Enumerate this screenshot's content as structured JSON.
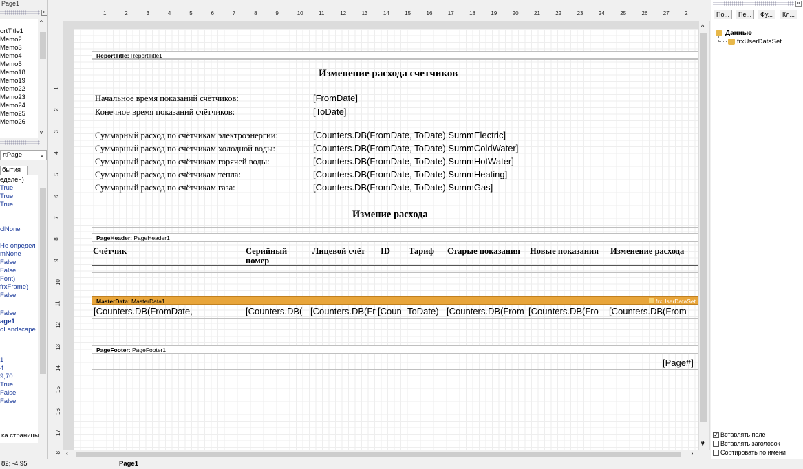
{
  "left_panel": {
    "tab_label": "Page1",
    "tree_items": [
      "ortTitle1",
      "Memo2",
      "Memo3",
      "Memo4",
      "Memo5",
      "Memo18",
      "Memo19",
      "Memo22",
      "Memo23",
      "Memo24",
      "Memo25",
      "Memo26"
    ],
    "object_select": "rtPage",
    "events_tab": "бытия",
    "property_values": [
      "еделен)",
      "True",
      "True",
      "True",
      "",
      "",
      "clNone",
      "",
      "Не определ",
      "mNone",
      "False",
      "False",
      "Font)",
      "frxFrame)",
      "False",
      "",
      "False",
      "age1",
      "oLandscape",
      "",
      "",
      "1",
      "4",
      "9,70",
      "True",
      "False",
      "False"
    ],
    "property_description": "ка страницы"
  },
  "ruler": {
    "h_ticks": [
      "1",
      "2",
      "3",
      "4",
      "5",
      "6",
      "7",
      "8",
      "9",
      "10",
      "11",
      "12",
      "13",
      "14",
      "15",
      "16",
      "17",
      "18",
      "19",
      "20",
      "21",
      "22",
      "23",
      "24",
      "25",
      "26",
      "27",
      "2"
    ],
    "v_ticks": [
      "1",
      "2",
      "3",
      "4",
      "5",
      "6",
      "7",
      "8",
      "9",
      "10",
      "11",
      "12",
      "13",
      "14",
      "15",
      "16",
      "17",
      "18"
    ]
  },
  "report": {
    "report_title_band": {
      "type": "ReportTitle:",
      "name": "ReportTitle1"
    },
    "title": "Изменение расхода счетчиков",
    "labels": [
      "Начальное время показаний счётчиков:",
      "Конечное время показаний счётчиков:",
      "Суммарный расход по счётчикам электроэнергии:",
      "Суммарный расход по счётчикам холодной воды:",
      "Суммарный расход по счётчикам горячей воды:",
      "Суммарный расход по счётчикам тепла:",
      "Суммарный расход по счётчикам газа:"
    ],
    "fields": [
      "[FromDate]",
      "[ToDate]",
      "[Counters.DB(FromDate, ToDate).SummElectric]",
      "[Counters.DB(FromDate, ToDate).SummColdWater]",
      "[Counters.DB(FromDate, ToDate).SummHotWater]",
      "[Counters.DB(FromDate, ToDate).SummHeating]",
      "[Counters.DB(FromDate, ToDate).SummGas]"
    ],
    "subtitle": "Измение расхода",
    "page_header_band": {
      "type": "PageHeader:",
      "name": "PageHeader1"
    },
    "columns": [
      "Счётчик",
      "Серийный номер",
      "Лицевой счёт",
      "ID",
      "Тариф",
      "Старые показания",
      "Новые показания",
      "Изменение расхода"
    ],
    "master_band": {
      "type": "MasterData:",
      "name": "MasterData1",
      "dataset": "frxUserDataSet"
    },
    "data_cells": [
      "[Counters.DB(FromDate,",
      "[Counters.DB(",
      "[Counters.DB(Fr",
      "[Coun",
      "ToDate)",
      "[Counters.DB(From",
      "[Counters.DB(Fro",
      "[Counters.DB(From"
    ],
    "page_footer_band": {
      "type": "PageFooter:",
      "name": "PageFooter1"
    },
    "page_number": "[Page#]"
  },
  "right_panel": {
    "tabs": [
      "По...",
      "Пе...",
      "Фу...",
      "Кл..."
    ],
    "tree_root": "Данные",
    "tree_child": "frxUserDataSet",
    "options": [
      {
        "label": "Вставлять поле",
        "checked": true
      },
      {
        "label": "Вставлять заголовок",
        "checked": false
      },
      {
        "label": "Сортировать по имени",
        "checked": false
      }
    ]
  },
  "status": {
    "coords": "82; -4,95",
    "page": "Page1"
  },
  "colors": {
    "master_band": "#e8a53a",
    "background": "#f0f0f0"
  }
}
